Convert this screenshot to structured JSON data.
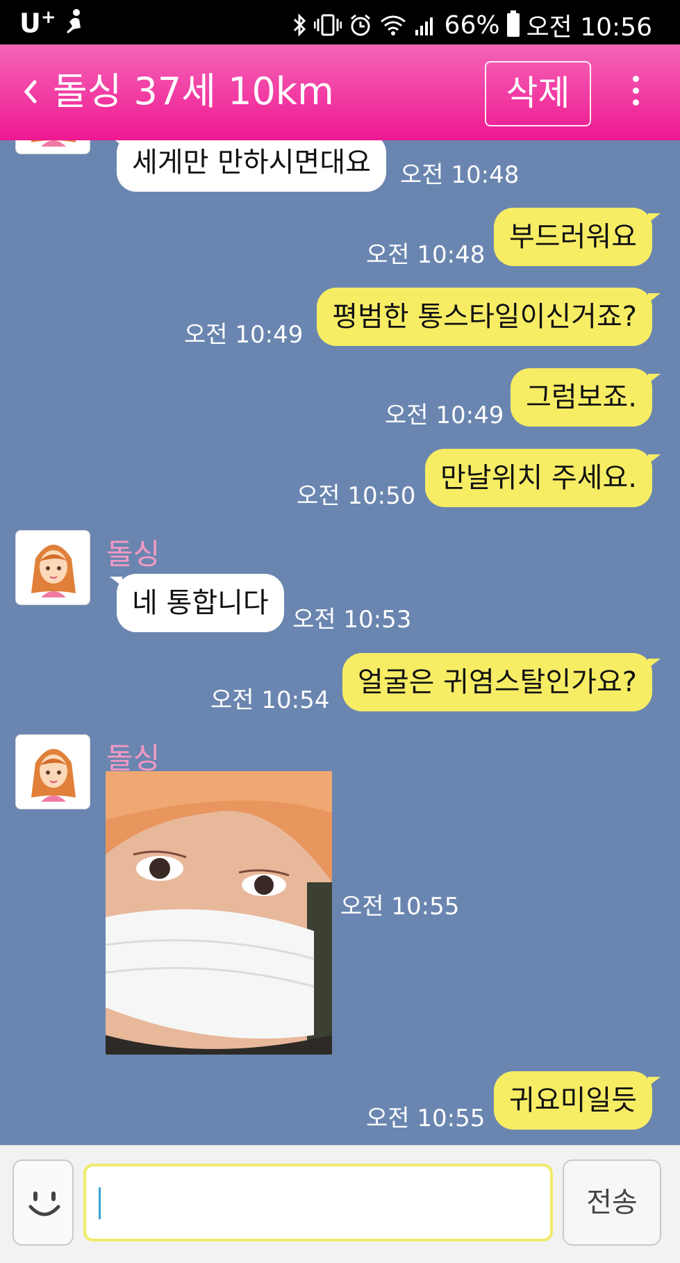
{
  "status_bar": {
    "carrier": "U",
    "carrier_plus": "+",
    "battery": "66%",
    "time": "오전 10:56",
    "icons": [
      "runner-icon",
      "bluetooth-icon",
      "vibrate-icon",
      "alarm-icon",
      "wifi-icon",
      "signal-icon",
      "battery-icon"
    ]
  },
  "header": {
    "title": "돌싱 37세 10km",
    "delete_label": "삭제",
    "back_icon": "chevron-left-icon",
    "menu_icon": "more-vert-icon",
    "bg_color": "#f0289a"
  },
  "chat": {
    "bg_color": "#6a86b0",
    "incoming_color": "#ffffff",
    "outgoing_color": "#f7ed65",
    "messages": [
      {
        "dir": "in",
        "text": "세게만 만하시면대요",
        "time": "오전 10:48"
      },
      {
        "dir": "out",
        "text": "부드러워요",
        "time": "오전 10:48"
      },
      {
        "dir": "out",
        "text": "평범한 통스타일이신거죠?",
        "time": "오전 10:49"
      },
      {
        "dir": "out",
        "text": "그럼보죠.",
        "time": "오전 10:49"
      },
      {
        "dir": "out",
        "text": "만날위치 주세요.",
        "time": "오전 10:50"
      },
      {
        "dir": "in",
        "sender": "돌싱",
        "text": "네 통합니다",
        "time": "오전 10:53"
      },
      {
        "dir": "out",
        "text": "얼굴은 귀염스탈인가요?",
        "time": "오전 10:54"
      },
      {
        "dir": "in",
        "sender": "돌싱",
        "type": "photo",
        "time": "오전 10:55"
      },
      {
        "dir": "out",
        "text": "귀요미일듯",
        "time": "오전 10:55"
      }
    ]
  },
  "input_bar": {
    "emoji_icon": "smiley-icon",
    "input_value": "",
    "send_label": "전송"
  }
}
